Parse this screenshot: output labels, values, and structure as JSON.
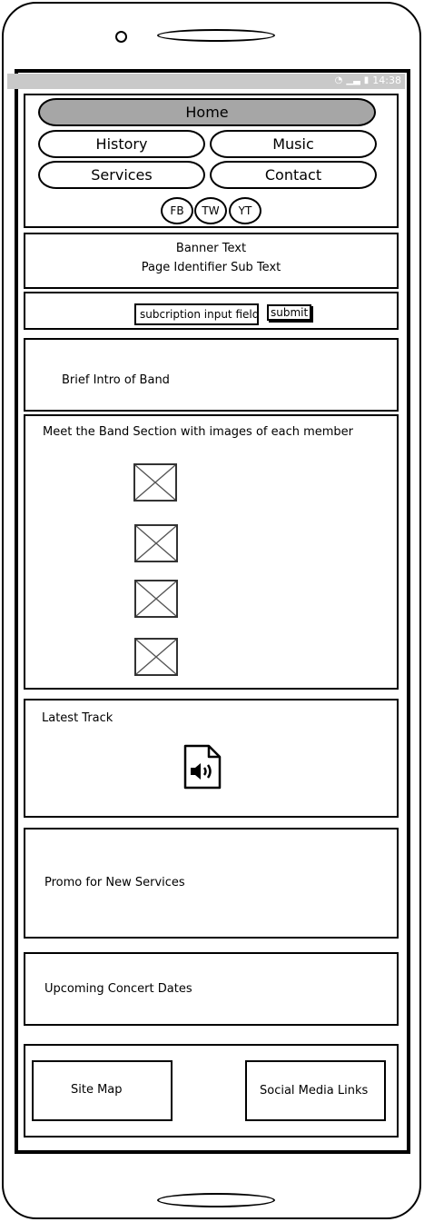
{
  "status_bar": {
    "time": "14:38"
  },
  "nav": {
    "home": "Home",
    "history": "History",
    "music": "Music",
    "services": "Services",
    "contact": "Contact"
  },
  "social_buttons": [
    "FB",
    "TW",
    "YT"
  ],
  "banner": {
    "title": "Banner Text",
    "subtitle": "Page Identifier Sub Text"
  },
  "subscription": {
    "input_value": "subcription input field",
    "submit_label": "submit"
  },
  "sections": {
    "intro": "Brief Intro of Band",
    "band": "Meet the Band Section with images of each member",
    "latest_track": "Latest Track",
    "promo": "Promo for New Services",
    "concerts": "Upcoming Concert Dates"
  },
  "band_member_images": [
    "image-placeholder",
    "image-placeholder",
    "image-placeholder",
    "image-placeholder"
  ],
  "footer": {
    "site_map": "Site Map",
    "social_links": "Social Media Links"
  },
  "icons": {
    "status": [
      "wifi-icon",
      "signal-icon",
      "battery-icon"
    ],
    "latest_track": "audio-file-icon",
    "member": "image-placeholder-icon"
  }
}
